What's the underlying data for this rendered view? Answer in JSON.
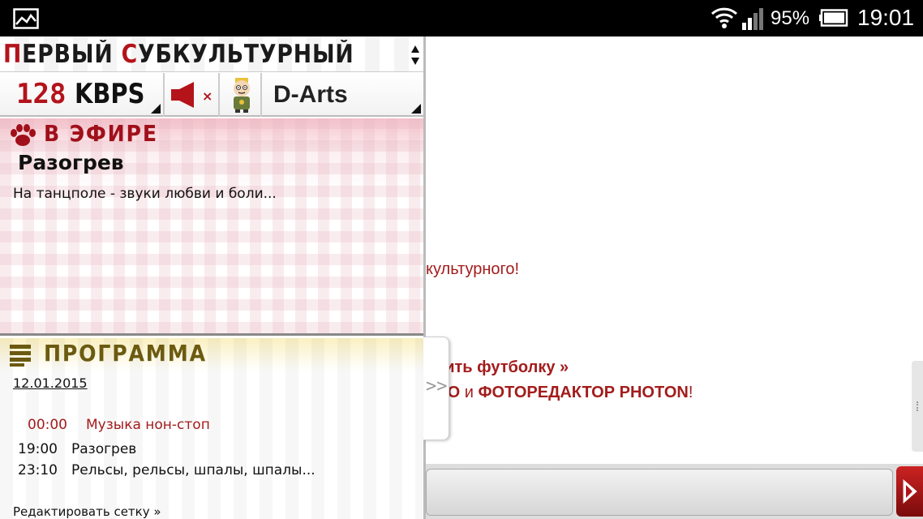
{
  "status_bar": {
    "battery_percent": "95%",
    "time": "19:01",
    "icons": [
      "gallery-icon",
      "wifi-icon",
      "signal-icon",
      "battery-icon"
    ]
  },
  "panel": {
    "title_caps": [
      "П",
      "С"
    ],
    "title_parts": [
      "ЕРВЫЙ ",
      "УБКУЛЬТУРНЫЙ"
    ],
    "bitrate_number": "128",
    "bitrate_unit": "KBPS",
    "mute_symbol": "×",
    "dj_name": "D-Arts"
  },
  "on_air": {
    "heading": "В ЭФИРЕ",
    "show_name": "Разогрев",
    "description": "На танцполе - звуки любви и боли..."
  },
  "schedule": {
    "heading": "ПРОГРАММА",
    "date": "12.01.2015",
    "items": [
      {
        "time": "00:00",
        "title": "Музыка нон-стоп"
      },
      {
        "time": "19:00",
        "title": "Разогрев"
      },
      {
        "time": "23:10",
        "title": "Рельсы, рельсы, шпалы, шпалы..."
      }
    ],
    "edit_link": "Редактировать сетку »"
  },
  "collapse_tab": ">>",
  "background_page": {
    "line1": "культурного!",
    "line2": "упить футболку »",
    "line3_a": "ОГО",
    "line3_and": " и ",
    "line3_b": "ФОТОРЕДАКТОР PHOTON",
    "line3_end": "!"
  },
  "colors": {
    "brand_red": "#b4131a",
    "link_red": "#a31c1c",
    "schedule_olive": "#6b5a10"
  }
}
